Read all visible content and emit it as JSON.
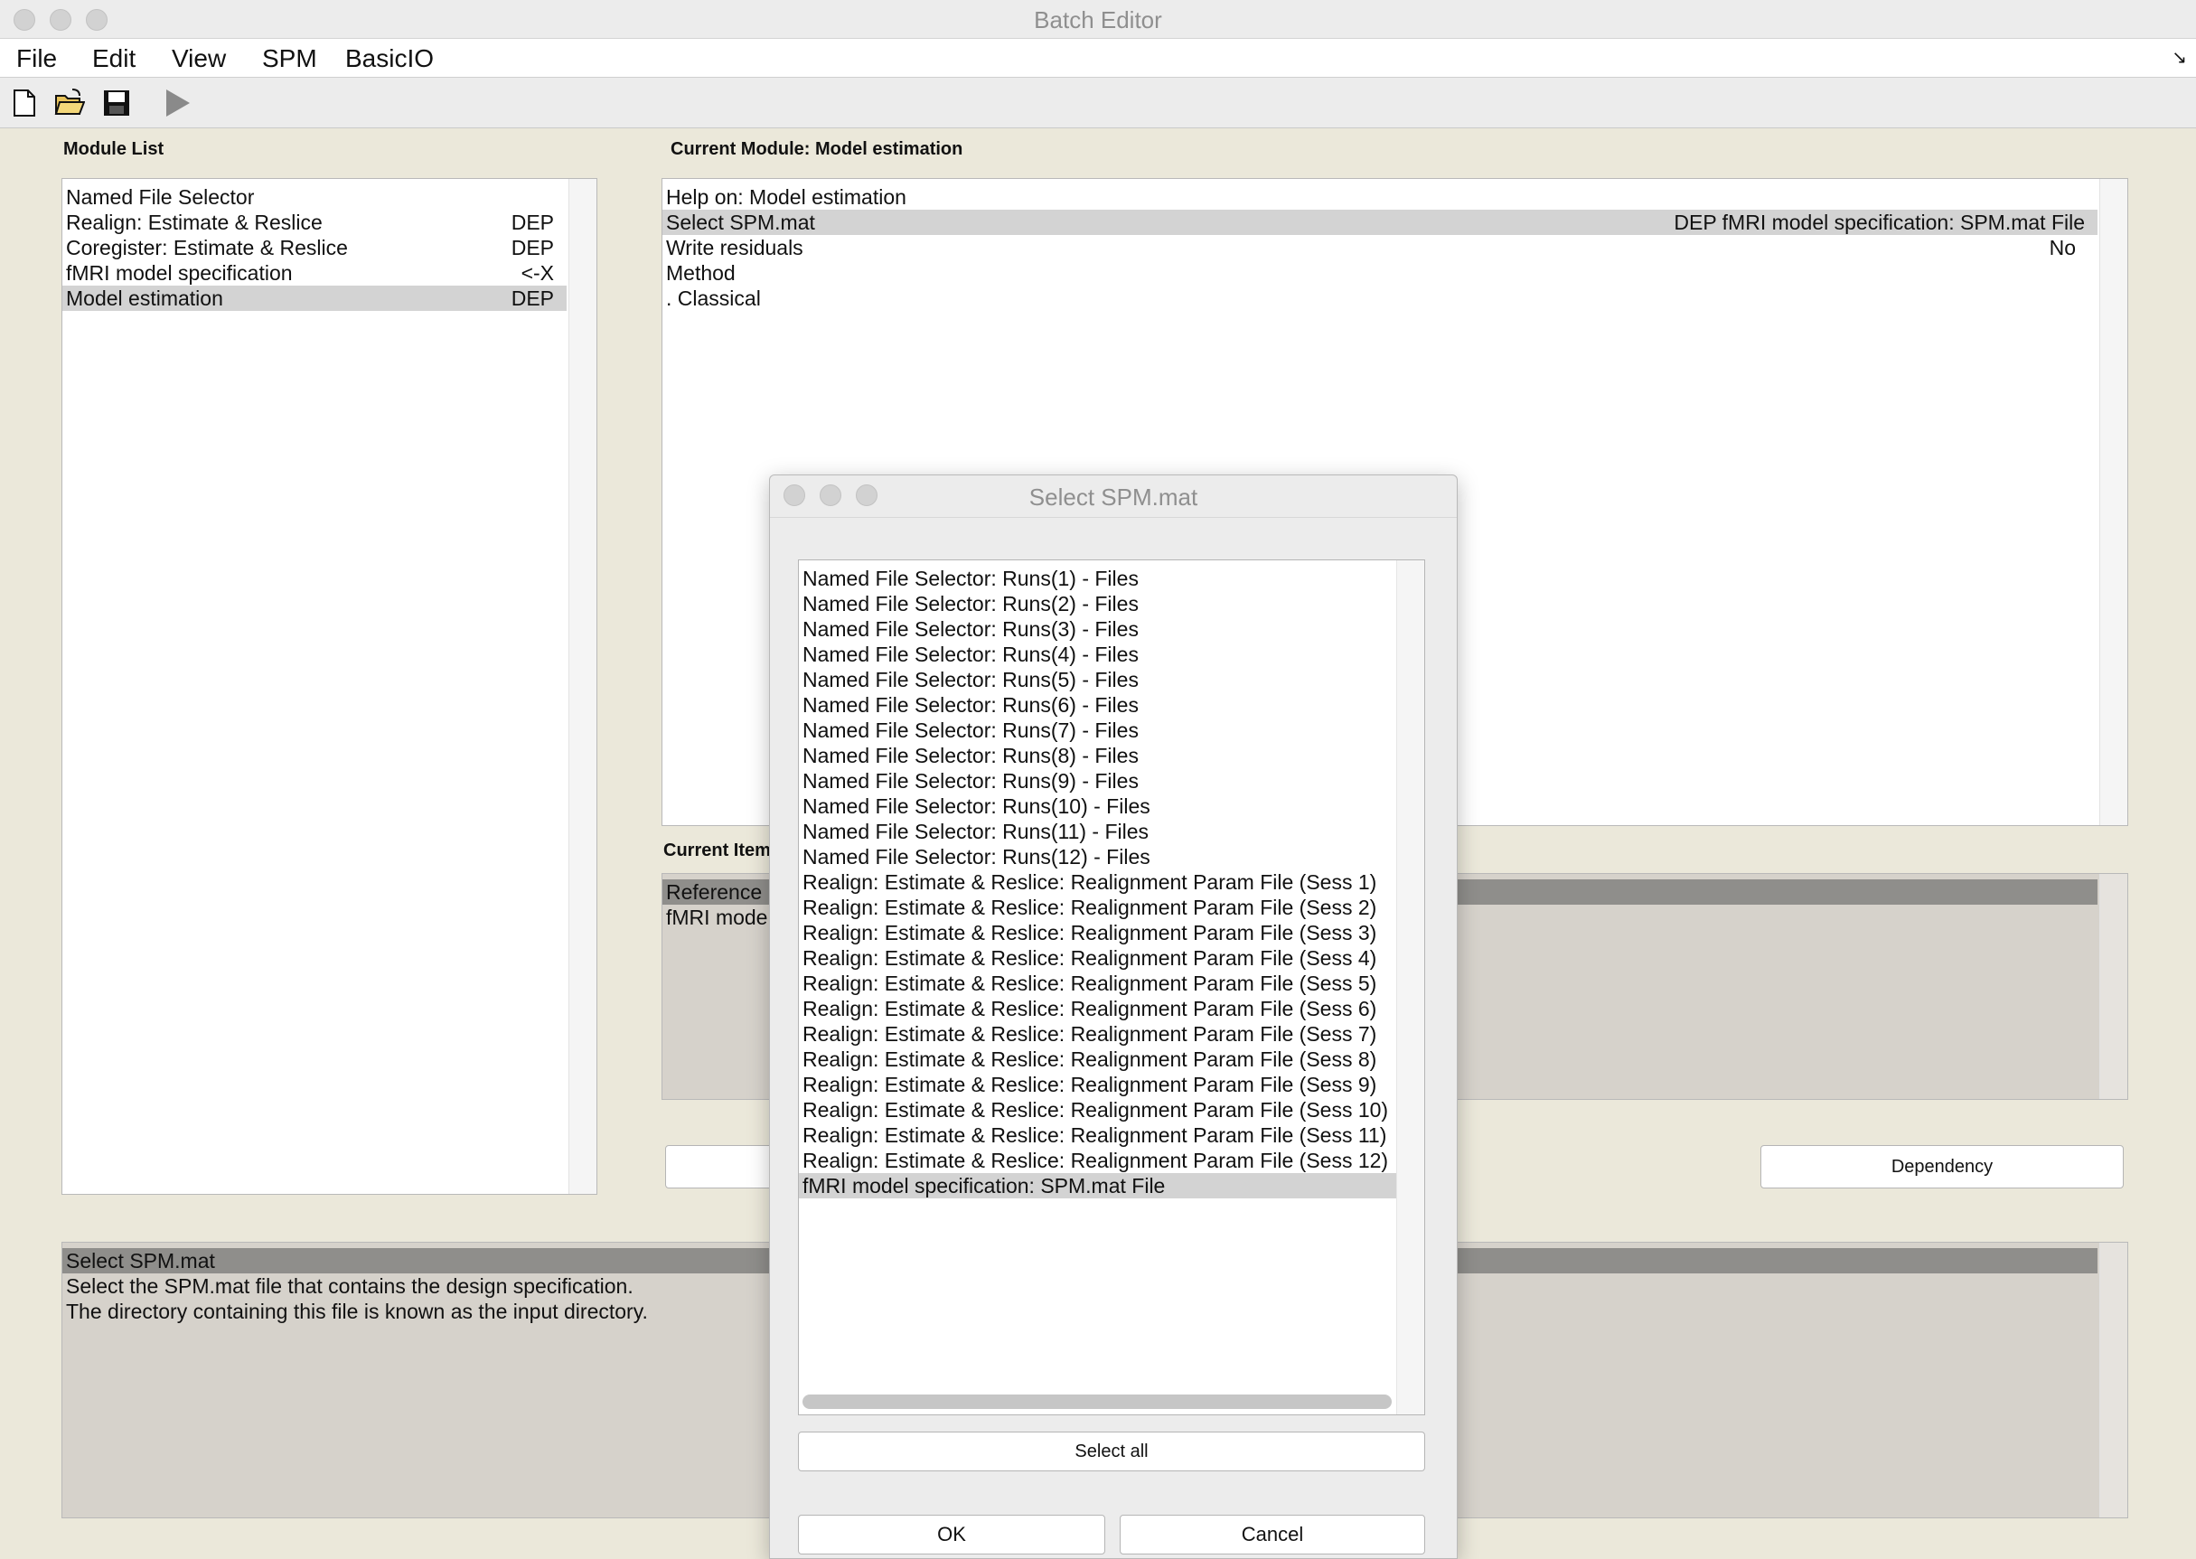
{
  "window": {
    "title": "Batch Editor"
  },
  "menu": [
    "File",
    "Edit",
    "View",
    "SPM",
    "BasicIO"
  ],
  "toolbar": {
    "icons": [
      "new-file-icon",
      "open-folder-icon",
      "save-icon",
      "run-icon"
    ]
  },
  "module_list": {
    "label": "Module List",
    "items": [
      {
        "name": "Named File Selector",
        "status": ""
      },
      {
        "name": "Realign: Estimate & Reslice",
        "status": "DEP"
      },
      {
        "name": "Coregister: Estimate & Reslice",
        "status": "DEP"
      },
      {
        "name": "fMRI model specification",
        "status": "<-X"
      },
      {
        "name": "Model estimation",
        "status": "DEP"
      }
    ]
  },
  "current_module": {
    "label": "Current Module: Model estimation",
    "items": [
      {
        "name": "Help on: Model estimation",
        "value": ""
      },
      {
        "name": "Select SPM.mat",
        "value": "DEP fMRI model specification: SPM.mat File"
      },
      {
        "name": "Write residuals",
        "value": "No"
      },
      {
        "name": "Method",
        "value": ""
      },
      {
        "name": " . Classical",
        "value": ""
      }
    ]
  },
  "current_item": {
    "label": "Current Item",
    "lines": [
      "Reference",
      "fMRI mode"
    ]
  },
  "buttons": {
    "dependency": "Dependency"
  },
  "help": {
    "lines": [
      "Select SPM.mat",
      "Select the SPM.mat file that contains the design specification.",
      "The directory containing this file is known as the input directory."
    ]
  },
  "dialog": {
    "title": "Select SPM.mat",
    "items": [
      "Named File Selector: Runs(1) - Files",
      "Named File Selector: Runs(2) - Files",
      "Named File Selector: Runs(3) - Files",
      "Named File Selector: Runs(4) - Files",
      "Named File Selector: Runs(5) - Files",
      "Named File Selector: Runs(6) - Files",
      "Named File Selector: Runs(7) - Files",
      "Named File Selector: Runs(8) - Files",
      "Named File Selector: Runs(9) - Files",
      "Named File Selector: Runs(10) - Files",
      "Named File Selector: Runs(11) - Files",
      "Named File Selector: Runs(12) - Files",
      "Realign: Estimate & Reslice: Realignment Param File (Sess 1)",
      "Realign: Estimate & Reslice: Realignment Param File (Sess 2)",
      "Realign: Estimate & Reslice: Realignment Param File (Sess 3)",
      "Realign: Estimate & Reslice: Realignment Param File (Sess 4)",
      "Realign: Estimate & Reslice: Realignment Param File (Sess 5)",
      "Realign: Estimate & Reslice: Realignment Param File (Sess 6)",
      "Realign: Estimate & Reslice: Realignment Param File (Sess 7)",
      "Realign: Estimate & Reslice: Realignment Param File (Sess 8)",
      "Realign: Estimate & Reslice: Realignment Param File (Sess 9)",
      "Realign: Estimate & Reslice: Realignment Param File (Sess 10)",
      "Realign: Estimate & Reslice: Realignment Param File (Sess 11)",
      "Realign: Estimate & Reslice: Realignment Param File (Sess 12)",
      "fMRI model specification: SPM.mat File"
    ],
    "selected_index": 24,
    "select_all": "Select all",
    "ok": "OK",
    "cancel": "Cancel"
  }
}
